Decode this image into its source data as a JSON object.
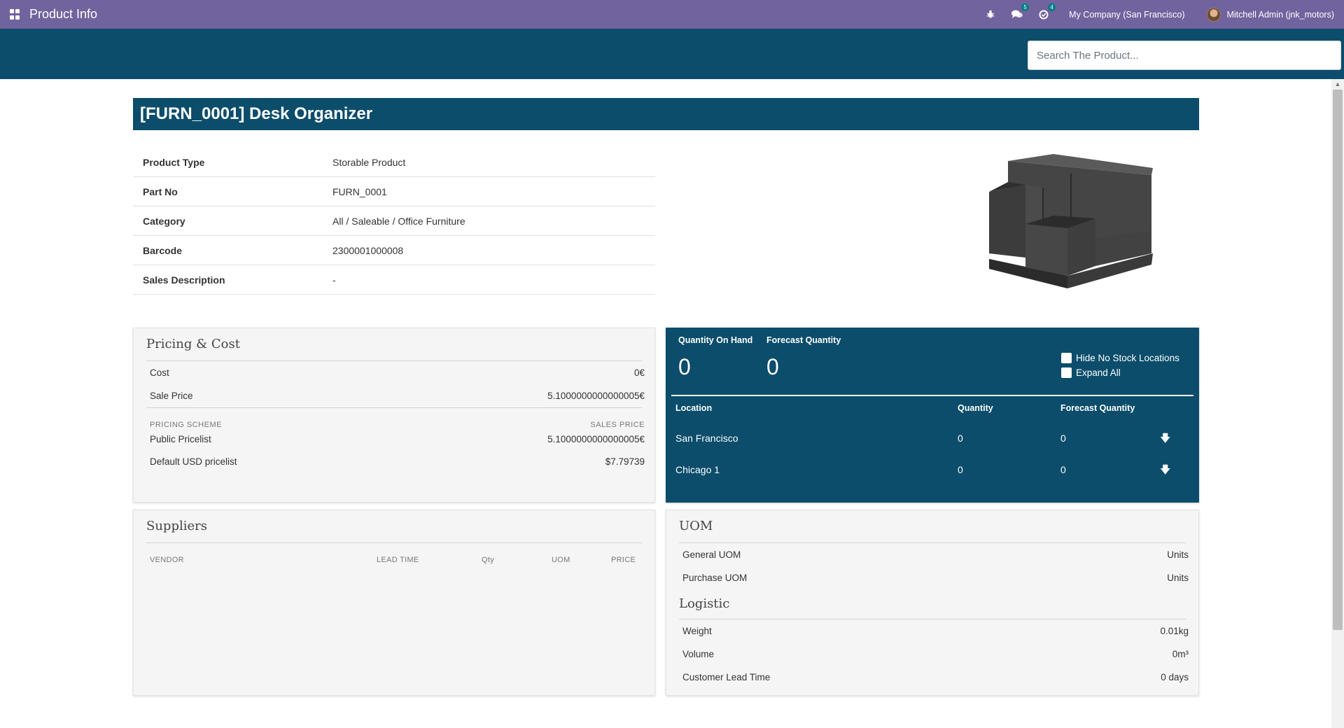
{
  "navbar": {
    "title": "Product Info",
    "activity_badge": "5",
    "messages_badge": "4",
    "company": "My Company (San Francisco)",
    "user": "Mitchell Admin (jnk_motors)"
  },
  "search": {
    "placeholder": "Search The Product..."
  },
  "product": {
    "title": "[FURN_0001] Desk Organizer",
    "info": [
      {
        "label": "Product Type",
        "value": "Storable Product"
      },
      {
        "label": "Part No",
        "value": "FURN_0001"
      },
      {
        "label": "Category",
        "value": "All / Saleable / Office Furniture"
      },
      {
        "label": "Barcode",
        "value": "2300001000008"
      },
      {
        "label": "Sales Description",
        "value": "-"
      }
    ]
  },
  "pricing": {
    "title": "Pricing & Cost",
    "cost_label": "Cost",
    "cost_value": "0€",
    "sale_label": "Sale Price",
    "sale_value": "5.1000000000000005€",
    "scheme_header": "PRICING SCHEME",
    "sales_price_header": "SALES PRICE",
    "pricelists": [
      {
        "name": "Public Pricelist",
        "price": "5.1000000000000005€"
      },
      {
        "name": "Default USD pricelist",
        "price": "$7.79739"
      }
    ]
  },
  "stock": {
    "on_hand_label": "Quantity On Hand",
    "on_hand_value": "0",
    "forecast_label": "Forecast Quantity",
    "forecast_value": "0",
    "hide_no_stock": "Hide No Stock Locations",
    "expand_all": "Expand All",
    "columns": {
      "location": "Location",
      "quantity": "Quantity",
      "forecast": "Forecast Quantity"
    },
    "rows": [
      {
        "location": "San Francisco",
        "quantity": "0",
        "forecast": "0"
      },
      {
        "location": "Chicago 1",
        "quantity": "0",
        "forecast": "0"
      }
    ]
  },
  "suppliers": {
    "title": "Suppliers",
    "columns": {
      "vendor": "VENDOR",
      "lead_time": "LEAD TIME",
      "qty": "Qty",
      "uom": "UOM",
      "price": "PRICE"
    }
  },
  "uom": {
    "title": "UOM",
    "general_label": "General UOM",
    "general_value": "Units",
    "purchase_label": "Purchase UOM",
    "purchase_value": "Units",
    "logistic_title": "Logistic",
    "weight_label": "Weight",
    "weight_value": "0.01kg",
    "volume_label": "Volume",
    "volume_value": "0m³",
    "lead_label": "Customer Lead Time",
    "lead_value": "0 days"
  },
  "colors": {
    "navbar": "#71639e",
    "primary": "#0b4d6b",
    "badge": "#017e84"
  },
  "icons": [
    "apps-icon",
    "bug-icon",
    "chat-icon",
    "activity-icon",
    "down-arrow-icon"
  ]
}
